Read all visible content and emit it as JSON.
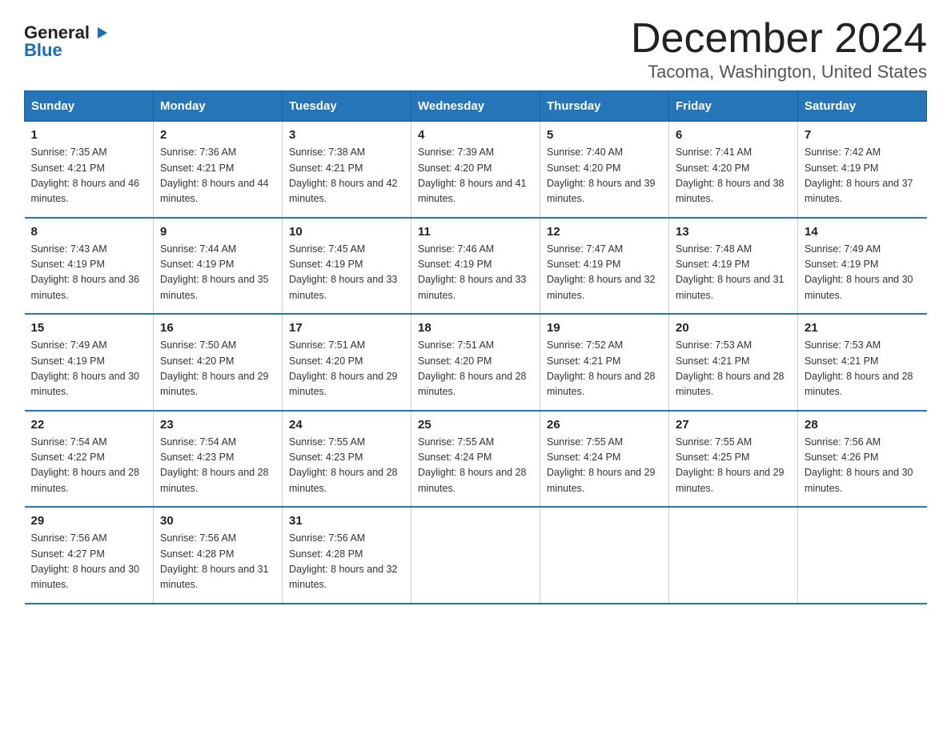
{
  "logo": {
    "general": "General",
    "blue": "Blue",
    "triangle_symbol": "▶"
  },
  "title": "December 2024",
  "subtitle": "Tacoma, Washington, United States",
  "weekdays": [
    "Sunday",
    "Monday",
    "Tuesday",
    "Wednesday",
    "Thursday",
    "Friday",
    "Saturday"
  ],
  "weeks": [
    [
      {
        "day": "1",
        "sunrise": "7:35 AM",
        "sunset": "4:21 PM",
        "daylight": "8 hours and 46 minutes."
      },
      {
        "day": "2",
        "sunrise": "7:36 AM",
        "sunset": "4:21 PM",
        "daylight": "8 hours and 44 minutes."
      },
      {
        "day": "3",
        "sunrise": "7:38 AM",
        "sunset": "4:21 PM",
        "daylight": "8 hours and 42 minutes."
      },
      {
        "day": "4",
        "sunrise": "7:39 AM",
        "sunset": "4:20 PM",
        "daylight": "8 hours and 41 minutes."
      },
      {
        "day": "5",
        "sunrise": "7:40 AM",
        "sunset": "4:20 PM",
        "daylight": "8 hours and 39 minutes."
      },
      {
        "day": "6",
        "sunrise": "7:41 AM",
        "sunset": "4:20 PM",
        "daylight": "8 hours and 38 minutes."
      },
      {
        "day": "7",
        "sunrise": "7:42 AM",
        "sunset": "4:19 PM",
        "daylight": "8 hours and 37 minutes."
      }
    ],
    [
      {
        "day": "8",
        "sunrise": "7:43 AM",
        "sunset": "4:19 PM",
        "daylight": "8 hours and 36 minutes."
      },
      {
        "day": "9",
        "sunrise": "7:44 AM",
        "sunset": "4:19 PM",
        "daylight": "8 hours and 35 minutes."
      },
      {
        "day": "10",
        "sunrise": "7:45 AM",
        "sunset": "4:19 PM",
        "daylight": "8 hours and 33 minutes."
      },
      {
        "day": "11",
        "sunrise": "7:46 AM",
        "sunset": "4:19 PM",
        "daylight": "8 hours and 33 minutes."
      },
      {
        "day": "12",
        "sunrise": "7:47 AM",
        "sunset": "4:19 PM",
        "daylight": "8 hours and 32 minutes."
      },
      {
        "day": "13",
        "sunrise": "7:48 AM",
        "sunset": "4:19 PM",
        "daylight": "8 hours and 31 minutes."
      },
      {
        "day": "14",
        "sunrise": "7:49 AM",
        "sunset": "4:19 PM",
        "daylight": "8 hours and 30 minutes."
      }
    ],
    [
      {
        "day": "15",
        "sunrise": "7:49 AM",
        "sunset": "4:19 PM",
        "daylight": "8 hours and 30 minutes."
      },
      {
        "day": "16",
        "sunrise": "7:50 AM",
        "sunset": "4:20 PM",
        "daylight": "8 hours and 29 minutes."
      },
      {
        "day": "17",
        "sunrise": "7:51 AM",
        "sunset": "4:20 PM",
        "daylight": "8 hours and 29 minutes."
      },
      {
        "day": "18",
        "sunrise": "7:51 AM",
        "sunset": "4:20 PM",
        "daylight": "8 hours and 28 minutes."
      },
      {
        "day": "19",
        "sunrise": "7:52 AM",
        "sunset": "4:21 PM",
        "daylight": "8 hours and 28 minutes."
      },
      {
        "day": "20",
        "sunrise": "7:53 AM",
        "sunset": "4:21 PM",
        "daylight": "8 hours and 28 minutes."
      },
      {
        "day": "21",
        "sunrise": "7:53 AM",
        "sunset": "4:21 PM",
        "daylight": "8 hours and 28 minutes."
      }
    ],
    [
      {
        "day": "22",
        "sunrise": "7:54 AM",
        "sunset": "4:22 PM",
        "daylight": "8 hours and 28 minutes."
      },
      {
        "day": "23",
        "sunrise": "7:54 AM",
        "sunset": "4:23 PM",
        "daylight": "8 hours and 28 minutes."
      },
      {
        "day": "24",
        "sunrise": "7:55 AM",
        "sunset": "4:23 PM",
        "daylight": "8 hours and 28 minutes."
      },
      {
        "day": "25",
        "sunrise": "7:55 AM",
        "sunset": "4:24 PM",
        "daylight": "8 hours and 28 minutes."
      },
      {
        "day": "26",
        "sunrise": "7:55 AM",
        "sunset": "4:24 PM",
        "daylight": "8 hours and 29 minutes."
      },
      {
        "day": "27",
        "sunrise": "7:55 AM",
        "sunset": "4:25 PM",
        "daylight": "8 hours and 29 minutes."
      },
      {
        "day": "28",
        "sunrise": "7:56 AM",
        "sunset": "4:26 PM",
        "daylight": "8 hours and 30 minutes."
      }
    ],
    [
      {
        "day": "29",
        "sunrise": "7:56 AM",
        "sunset": "4:27 PM",
        "daylight": "8 hours and 30 minutes."
      },
      {
        "day": "30",
        "sunrise": "7:56 AM",
        "sunset": "4:28 PM",
        "daylight": "8 hours and 31 minutes."
      },
      {
        "day": "31",
        "sunrise": "7:56 AM",
        "sunset": "4:28 PM",
        "daylight": "8 hours and 32 minutes."
      },
      null,
      null,
      null,
      null
    ]
  ]
}
